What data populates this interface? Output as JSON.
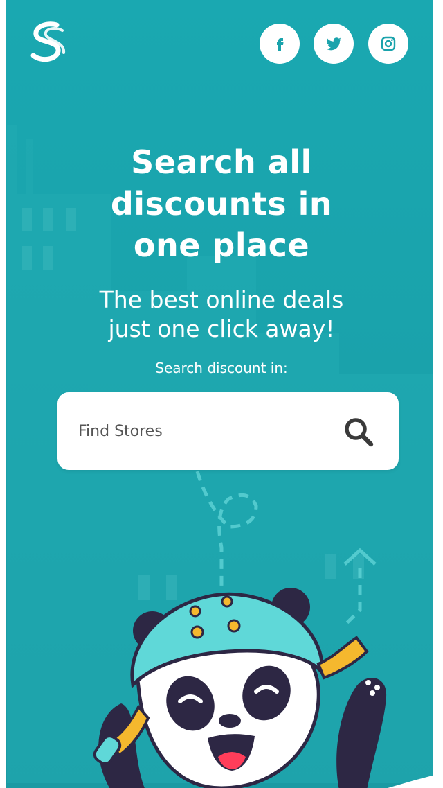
{
  "header": {
    "logo_icon": "brand-s-logo-icon",
    "social": [
      {
        "name": "facebook",
        "icon": "facebook-icon"
      },
      {
        "name": "twitter",
        "icon": "twitter-icon"
      },
      {
        "name": "instagram",
        "icon": "instagram-icon"
      }
    ]
  },
  "hero": {
    "title_lines": [
      "Search all",
      "discounts in",
      "one place"
    ],
    "subtitle_lines": [
      "The best online deals",
      "just one click away!"
    ],
    "search_label": "Search discount in:"
  },
  "search": {
    "placeholder": "Find Stores",
    "value": "",
    "icon": "search-icon"
  },
  "mascot": {
    "icon": "panda-mascot-illustration"
  },
  "colors": {
    "background": "#1aa3ac",
    "skyline": "#2bb2b8",
    "text": "#ffffff",
    "search_box": "#ffffff",
    "search_icon": "#3a3a3a",
    "helmet": "#5fd8d8",
    "helmet_dots": "#f5b82e",
    "panda_dark": "#2d2744"
  }
}
